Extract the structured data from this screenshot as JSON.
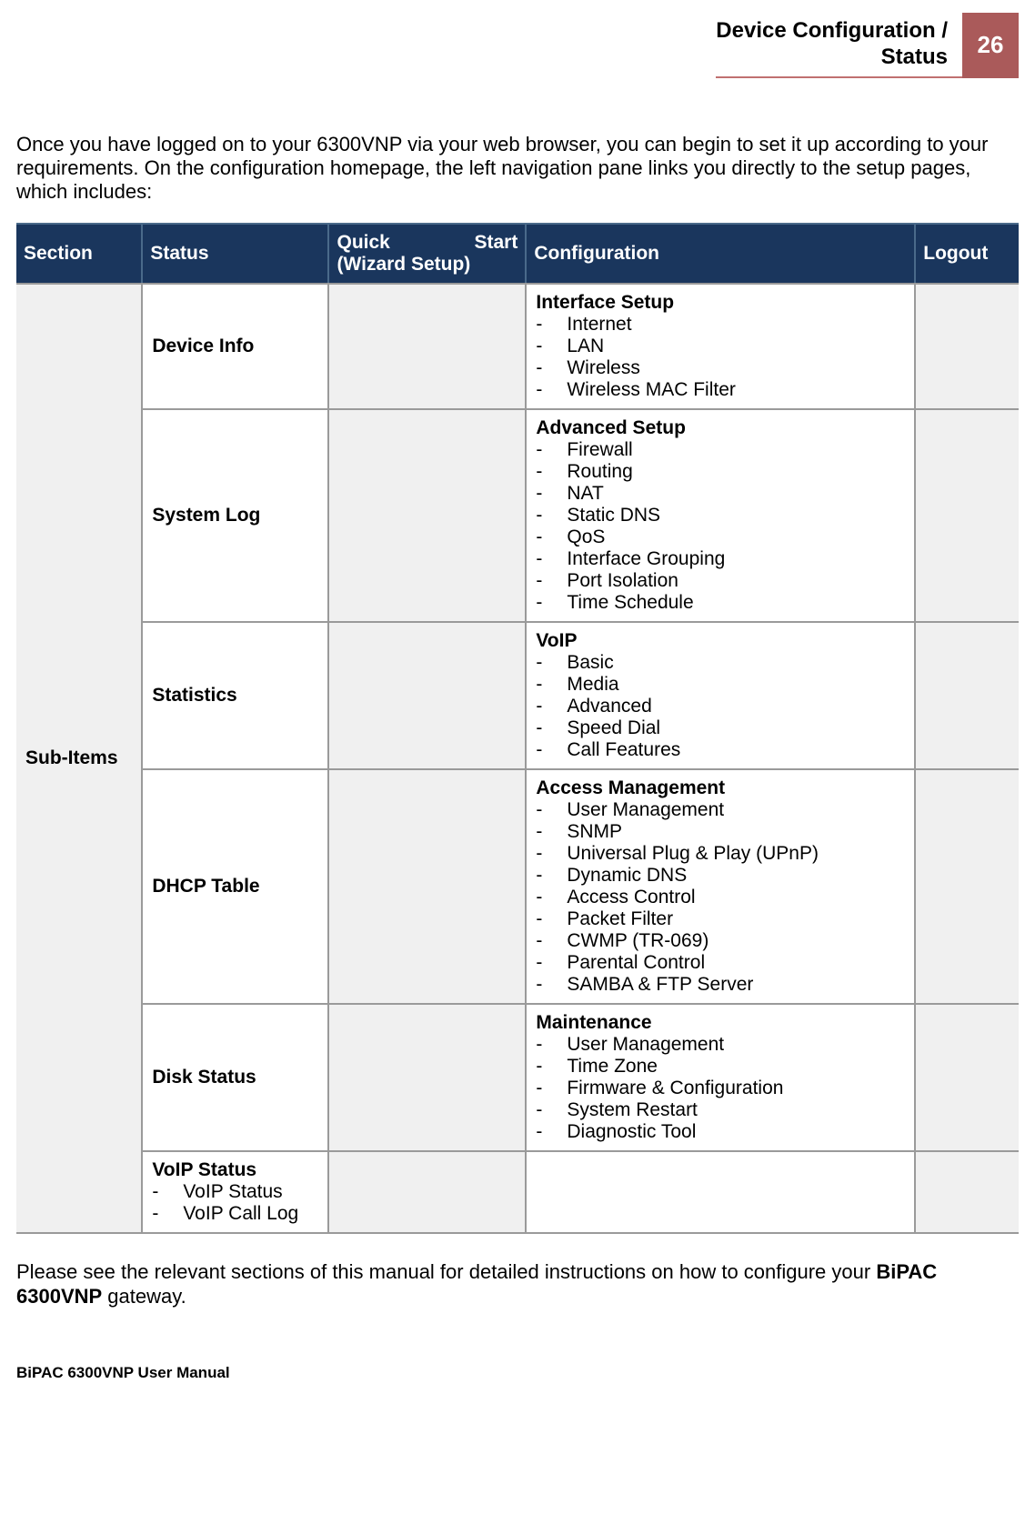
{
  "header": {
    "title": "Device Configuration /\nStatus",
    "page_number": "26"
  },
  "intro": "Once you have logged on to your 6300VNP via your web browser, you can begin to set it up according to your requirements. On the configuration homepage, the left navigation pane links you directly to the setup pages, which includes:",
  "table": {
    "headers": {
      "section": "Section",
      "status": "Status",
      "quick_start_a": "Quick",
      "quick_start_b": "Start",
      "quick_start_sub": "(Wizard Setup)",
      "configuration": "Configuration",
      "logout": "Logout"
    },
    "row_label": "Sub-Items",
    "rows": [
      {
        "status_title": "Device Info",
        "status_items": [],
        "config_title": "Interface Setup",
        "config_items": [
          "Internet",
          "LAN",
          "Wireless",
          "Wireless MAC Filter"
        ]
      },
      {
        "status_title": "System Log",
        "status_items": [],
        "config_title": "Advanced Setup",
        "config_items": [
          "Firewall",
          "Routing",
          "NAT",
          "Static DNS",
          "QoS",
          "Interface Grouping",
          "Port Isolation",
          "Time Schedule"
        ]
      },
      {
        "status_title": "Statistics",
        "status_items": [],
        "config_title": "VoIP",
        "config_items": [
          "Basic",
          "Media",
          "Advanced",
          "Speed Dial",
          "Call Features"
        ]
      },
      {
        "status_title": "DHCP Table",
        "status_items": [],
        "config_title": "Access Management",
        "config_items": [
          "User Management",
          "SNMP",
          "Universal Plug & Play (UPnP)",
          "Dynamic DNS",
          "Access Control",
          "Packet Filter",
          "CWMP (TR-069)",
          "Parental Control",
          "SAMBA & FTP Server"
        ]
      },
      {
        "status_title": "Disk Status",
        "status_items": [],
        "config_title": "Maintenance",
        "config_items": [
          "User Management",
          "Time Zone",
          "Firmware & Configuration",
          "System Restart",
          "Diagnostic Tool"
        ]
      },
      {
        "status_title": "VoIP Status",
        "status_items": [
          "VoIP Status",
          "VoIP Call Log"
        ],
        "config_title": "",
        "config_items": []
      }
    ]
  },
  "footnote_pre": "Please see the relevant sections of this manual for detailed instructions on how to configure your ",
  "footnote_bold": "BiPAC 6300VNP",
  "footnote_post": " gateway.",
  "footer": "BiPAC 6300VNP User Manual"
}
